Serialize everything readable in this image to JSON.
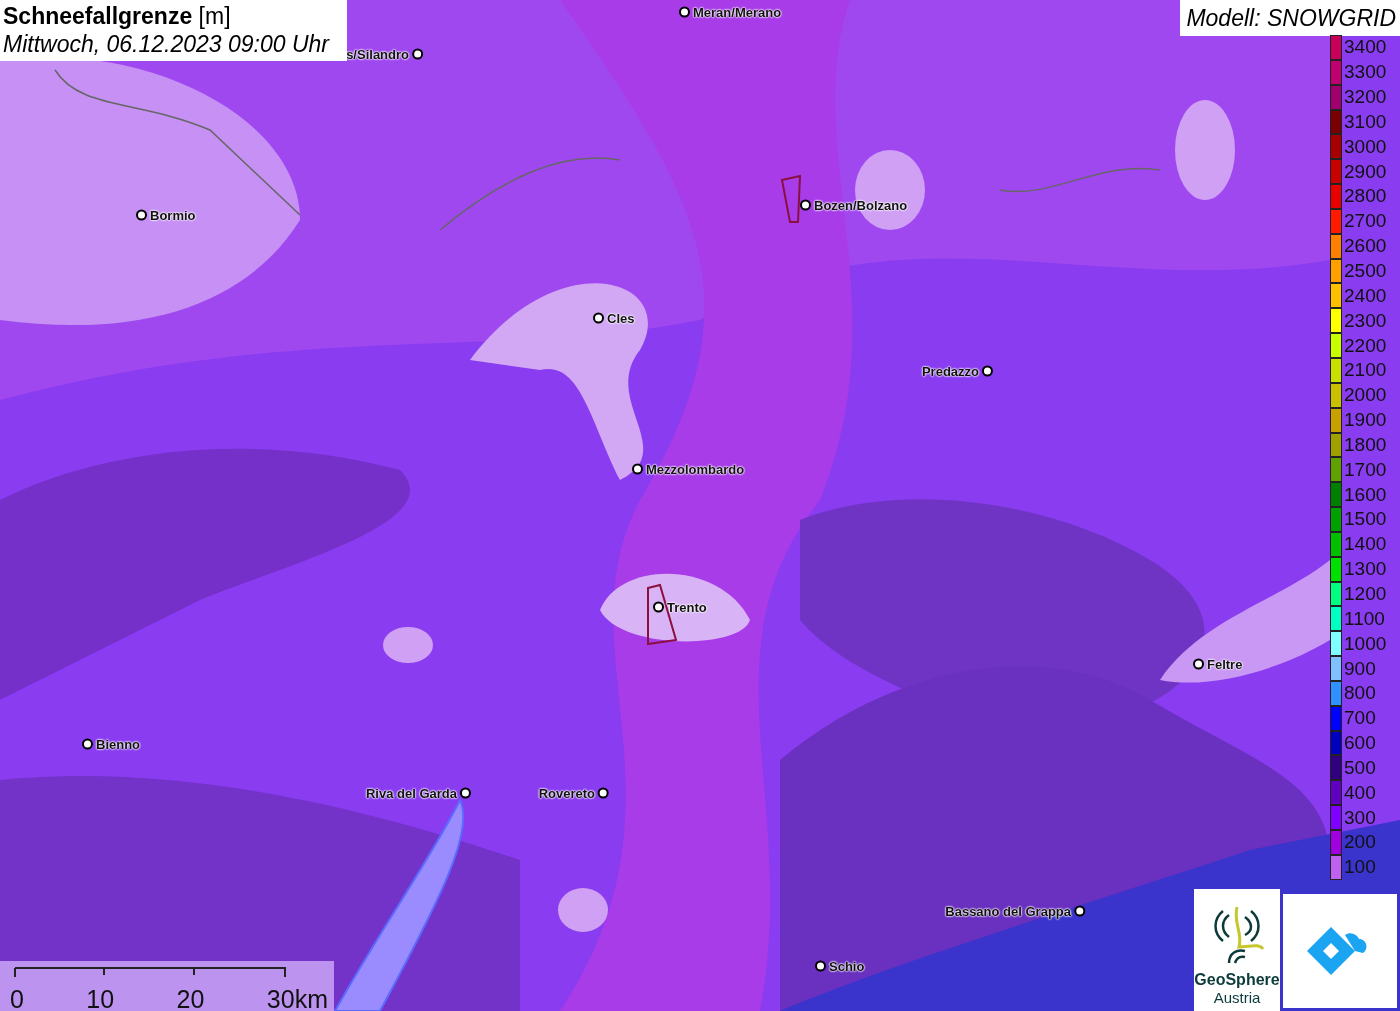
{
  "title": {
    "heading": "**Schneefallgrenze** [m]",
    "subtitle": "Mittwoch, 06.12.2023 09:00 Uhr"
  },
  "model": "Modell: SNOWGRID",
  "cities": [
    {
      "name": "Meran/Merano"
    },
    {
      "name": "s/Silandro"
    },
    {
      "name": "Bormio"
    },
    {
      "name": "Bozen/Bolzano"
    },
    {
      "name": "Cles"
    },
    {
      "name": "Predazzo"
    },
    {
      "name": "Mezzolombardo"
    },
    {
      "name": "Trento"
    },
    {
      "name": "Feltre"
    },
    {
      "name": "Bienno"
    },
    {
      "name": "Riva del Garda"
    },
    {
      "name": "Rovereto"
    },
    {
      "name": "Bassano del Grappa"
    },
    {
      "name": "Schio"
    }
  ],
  "legend": [
    {
      "label": "3400",
      "color": "#c8005a"
    },
    {
      "label": "3300",
      "color": "#c00070"
    },
    {
      "label": "3200",
      "color": "#a0006e"
    },
    {
      "label": "3100",
      "color": "#7a0000"
    },
    {
      "label": "3000",
      "color": "#a80000"
    },
    {
      "label": "2900",
      "color": "#c80000"
    },
    {
      "label": "2800",
      "color": "#e80000"
    },
    {
      "label": "2700",
      "color": "#ff1a00"
    },
    {
      "label": "2600",
      "color": "#ff8000"
    },
    {
      "label": "2500",
      "color": "#ffa000"
    },
    {
      "label": "2400",
      "color": "#ffc000"
    },
    {
      "label": "2300",
      "color": "#ffff00"
    },
    {
      "label": "2200",
      "color": "#c8ff00"
    },
    {
      "label": "2100",
      "color": "#c8e000"
    },
    {
      "label": "2000",
      "color": "#c8c000"
    },
    {
      "label": "1900",
      "color": "#c8a000"
    },
    {
      "label": "1800",
      "color": "#a0a000"
    },
    {
      "label": "1700",
      "color": "#60a000"
    },
    {
      "label": "1600",
      "color": "#008000"
    },
    {
      "label": "1500",
      "color": "#00a000"
    },
    {
      "label": "1400",
      "color": "#00c000"
    },
    {
      "label": "1300",
      "color": "#00e000"
    },
    {
      "label": "1200",
      "color": "#00ff80"
    },
    {
      "label": "1100",
      "color": "#00ffc0"
    },
    {
      "label": "1000",
      "color": "#80ffff"
    },
    {
      "label": "900",
      "color": "#80c0ff"
    },
    {
      "label": "800",
      "color": "#3090ff"
    },
    {
      "label": "700",
      "color": "#0000ff"
    },
    {
      "label": "600",
      "color": "#0000c0"
    },
    {
      "label": "500",
      "color": "#300080"
    },
    {
      "label": "400",
      "color": "#6000c0"
    },
    {
      "label": "300",
      "color": "#8000ff"
    },
    {
      "label": "200",
      "color": "#a000e0"
    },
    {
      "label": "100",
      "color": "#c060f0"
    }
  ],
  "scale": {
    "ticks": [
      "0",
      "10",
      "20",
      "30km"
    ]
  },
  "logo": {
    "line1": "GeoSphere",
    "line2": "Austria"
  }
}
